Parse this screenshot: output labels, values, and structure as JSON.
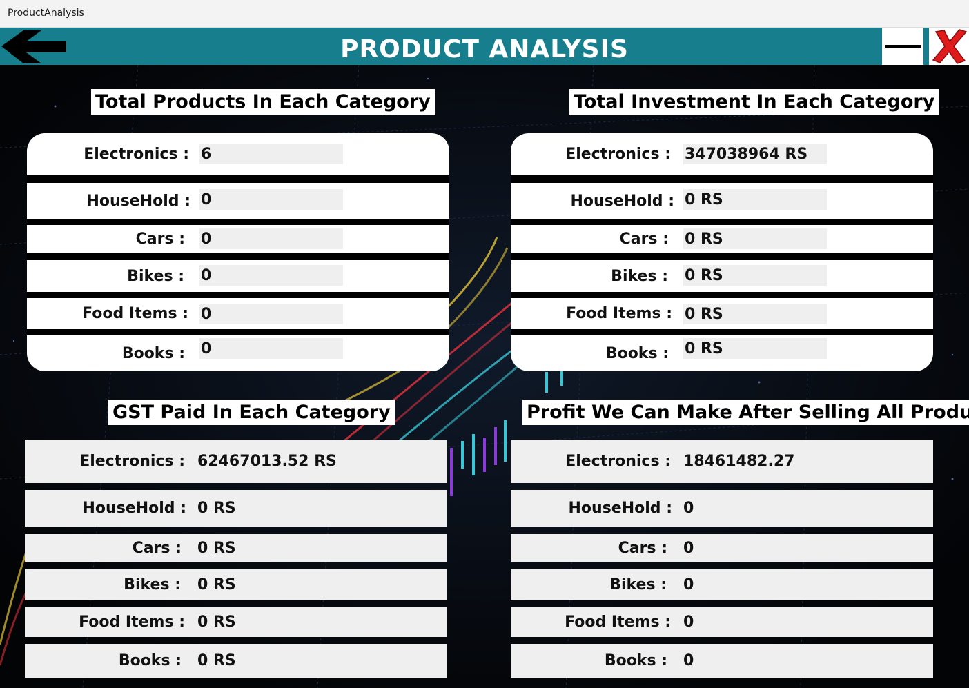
{
  "window": {
    "title": "ProductAnalysis"
  },
  "header": {
    "title": "PRODUCT ANALYSIS"
  },
  "colors": {
    "header": "#167e8c",
    "close": "#e01b1b"
  },
  "icons": {
    "back": "back-arrow-icon",
    "minimize": "minimize-icon",
    "close": "close-icon"
  },
  "total_products": {
    "title": "Total Products In Each Category",
    "rows": [
      {
        "label": "Electronics :",
        "value": "6"
      },
      {
        "label": "HouseHold :",
        "value": "0"
      },
      {
        "label": "Cars :",
        "value": "0"
      },
      {
        "label": "Bikes :",
        "value": "0"
      },
      {
        "label": "Food Items :",
        "value": "0"
      },
      {
        "label": "Books :",
        "value": "0"
      }
    ]
  },
  "total_investment": {
    "title": "Total Investment In Each Category",
    "rows": [
      {
        "label": "Electronics :",
        "value": "347038964 RS"
      },
      {
        "label": "HouseHold :",
        "value": "0 RS"
      },
      {
        "label": "Cars :",
        "value": "0 RS"
      },
      {
        "label": "Bikes :",
        "value": "0 RS"
      },
      {
        "label": "Food Items :",
        "value": "0 RS"
      },
      {
        "label": "Books :",
        "value": "0 RS"
      }
    ]
  },
  "gst_paid": {
    "title": "GST Paid In Each Category",
    "rows": [
      {
        "label": "Electronics :",
        "value": "62467013.52 RS"
      },
      {
        "label": "HouseHold :",
        "value": "0 RS"
      },
      {
        "label": "Cars :",
        "value": "0 RS"
      },
      {
        "label": "Bikes :",
        "value": "0 RS"
      },
      {
        "label": "Food Items :",
        "value": "0 RS"
      },
      {
        "label": "Books :",
        "value": "0 RS"
      }
    ]
  },
  "profit": {
    "title": "Profit We Can Make After Selling All Products",
    "rows": [
      {
        "label": "Electronics :",
        "value": "18461482.27"
      },
      {
        "label": "HouseHold :",
        "value": "0"
      },
      {
        "label": "Cars :",
        "value": "0"
      },
      {
        "label": "Bikes :",
        "value": "0"
      },
      {
        "label": "Food Items :",
        "value": "0"
      },
      {
        "label": "Books :",
        "value": "0"
      }
    ]
  }
}
